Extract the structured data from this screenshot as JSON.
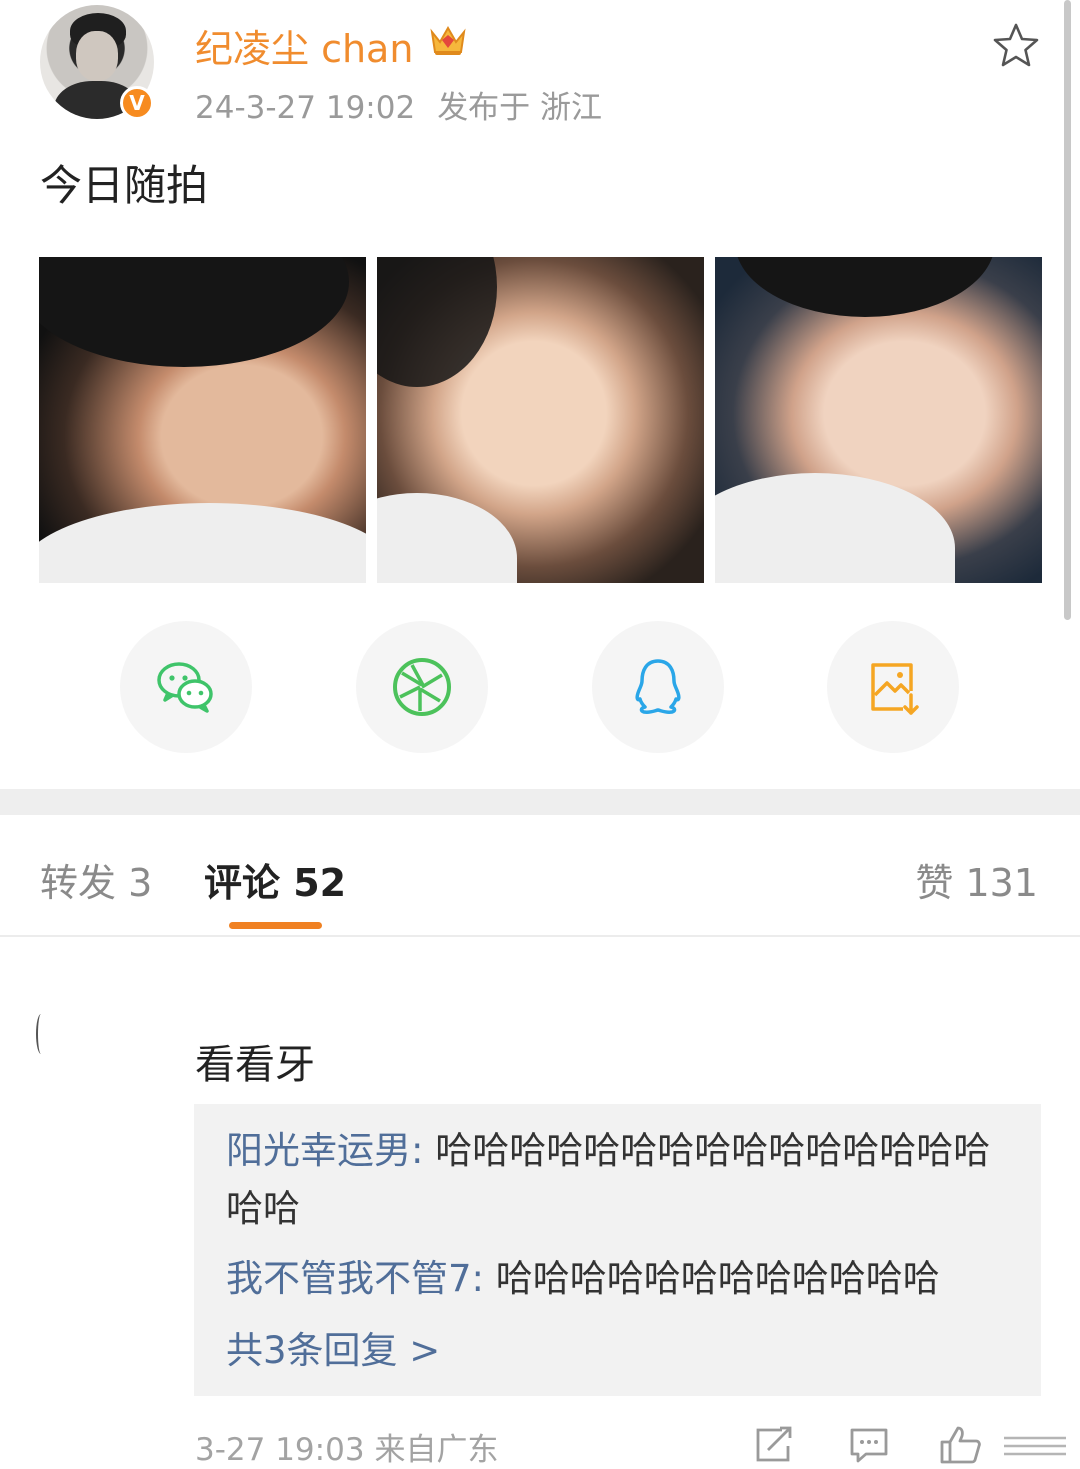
{
  "post": {
    "username": "纪凌尘 chan",
    "timestamp": "24-3-27 19:02",
    "location": "发布于 浙江",
    "text": "今日随拍",
    "verified_badge": "V",
    "photos": [
      "photo-1",
      "photo-2",
      "photo-3"
    ]
  },
  "share_targets": [
    {
      "icon": "wechat-icon"
    },
    {
      "icon": "moments-icon"
    },
    {
      "icon": "qq-icon"
    },
    {
      "icon": "save-image-icon"
    }
  ],
  "tabs": {
    "repost": "转发 3",
    "comments": "评论 52",
    "likes": "赞 131"
  },
  "comment": {
    "text": "看看牙",
    "replies": [
      {
        "name": "阳光幸运男",
        "sep": ": ",
        "text": "哈哈哈哈哈哈哈哈哈哈哈哈哈哈哈哈哈"
      },
      {
        "name": "我不管我不管7",
        "sep": ": ",
        "text": "哈哈哈哈哈哈哈哈哈哈哈哈"
      }
    ],
    "more_replies": "共3条回复 >",
    "time": "3-27 19:03",
    "source": "来自广东"
  },
  "colors": {
    "accent": "#f08122",
    "username": "#f08c2e",
    "link": "#506e99",
    "wechat": "#3fc46a",
    "moments": "#4cc25b",
    "qq": "#2aa6e8",
    "save": "#f5a623"
  }
}
